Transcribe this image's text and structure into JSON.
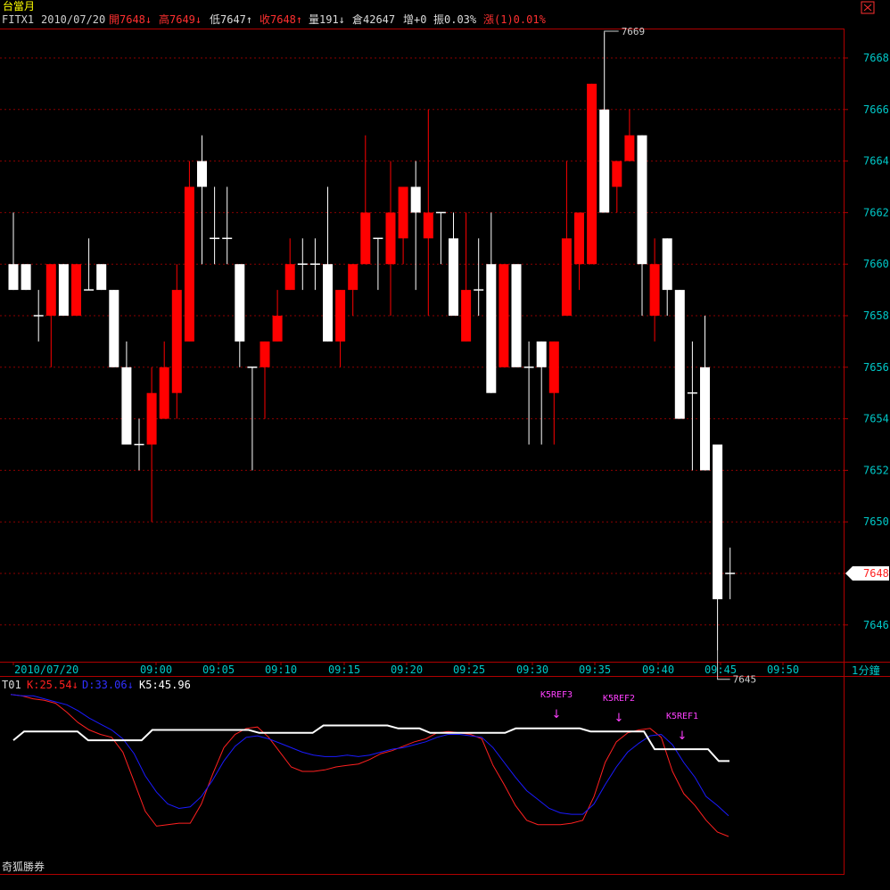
{
  "header": {
    "contract_title": "台當月",
    "symbol": "FITX1",
    "date": "2010/07/20",
    "open_label": "開7648↓",
    "high_label": "高7649↓",
    "low_label": "低7647↑",
    "close_label": "收7648↑",
    "volume_label": "量191↓",
    "oi_label": "倉42647",
    "oi_change_label": "增+0",
    "amplitude_label": "振0.03%",
    "change_label": "漲(1)0.01%",
    "close_button": "⊠"
  },
  "price_panel": {
    "axis_labels": [
      "7668",
      "7666",
      "7664",
      "7662",
      "7660",
      "7658",
      "7656",
      "7654",
      "7652",
      "7650",
      "7648",
      "7646"
    ],
    "current_price_tag": "7648",
    "high_annotation": "7669",
    "low_annotation": "7645",
    "time_labels": [
      "2010/07/20",
      "09:00",
      "09:05",
      "09:10",
      "09:15",
      "09:20",
      "09:25",
      "09:30",
      "09:35",
      "09:40",
      "09:45",
      "09:50"
    ],
    "interval_label": "1分鐘"
  },
  "indicator_panel": {
    "name": "T01",
    "k_label": "K:25.54↓",
    "d_label": "D:33.06↓",
    "k5_label": "K5:45.96",
    "markers": [
      {
        "label": "K5REF3",
        "arrow": "↓"
      },
      {
        "label": "K5REF2",
        "arrow": "↓"
      },
      {
        "label": "K5REF1",
        "arrow": "↓"
      }
    ]
  },
  "footer": {
    "brand": "奇狐勝券"
  },
  "colors": {
    "background": "#000000",
    "up_candle": "#ff0000",
    "down_candle": "#ffffff",
    "axis_text": "#00c8c8",
    "grid": "#8b0000",
    "k_line": "#ff2020",
    "d_line": "#1a1aff",
    "k5_line": "#ffffff",
    "marker_text": "#ff40ff",
    "title_yellow": "#ffff00"
  },
  "chart_data": [
    {
      "type": "candlestick",
      "title": "FITX1 1分鐘",
      "y_range": [
        7644.5,
        7670
      ],
      "candles": [
        {
          "o": 7660,
          "h": 7662,
          "l": 7659,
          "c": 7659
        },
        {
          "o": 7660,
          "h": 7660,
          "l": 7659,
          "c": 7659
        },
        {
          "o": 7658,
          "h": 7659,
          "l": 7657,
          "c": 7658
        },
        {
          "o": 7658,
          "h": 7660,
          "l": 7656,
          "c": 7660
        },
        {
          "o": 7660,
          "h": 7660,
          "l": 7658,
          "c": 7658
        },
        {
          "o": 7658,
          "h": 7660,
          "l": 7658,
          "c": 7660
        },
        {
          "o": 7659,
          "h": 7661,
          "l": 7659,
          "c": 7659
        },
        {
          "o": 7660,
          "h": 7660,
          "l": 7659,
          "c": 7659
        },
        {
          "o": 7659,
          "h": 7659,
          "l": 7656,
          "c": 7656
        },
        {
          "o": 7656,
          "h": 7657,
          "l": 7653,
          "c": 7653
        },
        {
          "o": 7653,
          "h": 7654,
          "l": 7652,
          "c": 7653
        },
        {
          "o": 7653,
          "h": 7656,
          "l": 7650,
          "c": 7655
        },
        {
          "o": 7654,
          "h": 7657,
          "l": 7654,
          "c": 7656
        },
        {
          "o": 7655,
          "h": 7660,
          "l": 7654,
          "c": 7659
        },
        {
          "o": 7657,
          "h": 7664,
          "l": 7657,
          "c": 7663
        },
        {
          "o": 7664,
          "h": 7665,
          "l": 7660,
          "c": 7663
        },
        {
          "o": 7661,
          "h": 7663,
          "l": 7660,
          "c": 7661
        },
        {
          "o": 7661,
          "h": 7663,
          "l": 7660,
          "c": 7661
        },
        {
          "o": 7660,
          "h": 7660,
          "l": 7656,
          "c": 7657
        },
        {
          "o": 7656,
          "h": 7656,
          "l": 7652,
          "c": 7656
        },
        {
          "o": 7656,
          "h": 7657,
          "l": 7654,
          "c": 7657
        },
        {
          "o": 7657,
          "h": 7659,
          "l": 7657,
          "c": 7658
        },
        {
          "o": 7659,
          "h": 7661,
          "l": 7659,
          "c": 7660
        },
        {
          "o": 7660,
          "h": 7661,
          "l": 7659,
          "c": 7660
        },
        {
          "o": 7660,
          "h": 7661,
          "l": 7659,
          "c": 7660
        },
        {
          "o": 7660,
          "h": 7663,
          "l": 7657,
          "c": 7657
        },
        {
          "o": 7657,
          "h": 7659,
          "l": 7656,
          "c": 7659
        },
        {
          "o": 7659,
          "h": 7660,
          "l": 7658,
          "c": 7660
        },
        {
          "o": 7660,
          "h": 7665,
          "l": 7660,
          "c": 7662
        },
        {
          "o": 7661,
          "h": 7661,
          "l": 7659,
          "c": 7661
        },
        {
          "o": 7660,
          "h": 7664,
          "l": 7658,
          "c": 7662
        },
        {
          "o": 7661,
          "h": 7663,
          "l": 7660,
          "c": 7663
        },
        {
          "o": 7663,
          "h": 7664,
          "l": 7659,
          "c": 7662
        },
        {
          "o": 7661,
          "h": 7666,
          "l": 7658,
          "c": 7662
        },
        {
          "o": 7662,
          "h": 7662,
          "l": 7660,
          "c": 7662
        },
        {
          "o": 7661,
          "h": 7662,
          "l": 7660,
          "c": 7658
        },
        {
          "o": 7657,
          "h": 7662,
          "l": 7657,
          "c": 7659
        },
        {
          "o": 7659,
          "h": 7661,
          "l": 7658,
          "c": 7659
        },
        {
          "o": 7660,
          "h": 7662,
          "l": 7655,
          "c": 7655
        },
        {
          "o": 7656,
          "h": 7660,
          "l": 7656,
          "c": 7660
        },
        {
          "o": 7660,
          "h": 7660,
          "l": 7656,
          "c": 7656
        },
        {
          "o": 7656,
          "h": 7657,
          "l": 7653,
          "c": 7656
        },
        {
          "o": 7657,
          "h": 7657,
          "l": 7653,
          "c": 7656
        },
        {
          "o": 7655,
          "h": 7657,
          "l": 7653,
          "c": 7657
        },
        {
          "o": 7658,
          "h": 7664,
          "l": 7658,
          "c": 7661
        },
        {
          "o": 7660,
          "h": 7662,
          "l": 7659,
          "c": 7662
        },
        {
          "o": 7660,
          "h": 7667,
          "l": 7660,
          "c": 7667
        },
        {
          "o": 7666,
          "h": 7669,
          "l": 7662,
          "c": 7662
        },
        {
          "o": 7663,
          "h": 7664,
          "l": 7662,
          "c": 7664
        },
        {
          "o": 7664,
          "h": 7666,
          "l": 7664,
          "c": 7665
        },
        {
          "o": 7665,
          "h": 7665,
          "l": 7658,
          "c": 7660
        },
        {
          "o": 7658,
          "h": 7661,
          "l": 7657,
          "c": 7660
        },
        {
          "o": 7661,
          "h": 7661,
          "l": 7658,
          "c": 7659
        },
        {
          "o": 7659,
          "h": 7659,
          "l": 7654,
          "c": 7654
        },
        {
          "o": 7655,
          "h": 7657,
          "l": 7652,
          "c": 7655
        },
        {
          "o": 7656,
          "h": 7658,
          "l": 7652,
          "c": 7652
        },
        {
          "o": 7653,
          "h": 7653,
          "l": 7645,
          "c": 7647
        },
        {
          "o": 7648,
          "h": 7649,
          "l": 7647,
          "c": 7648
        }
      ]
    },
    {
      "type": "line",
      "title": "T01",
      "y_range": [
        0,
        100
      ],
      "series": [
        {
          "name": "K",
          "values": [
            99,
            98,
            96,
            95,
            93,
            87,
            80,
            75,
            72,
            70,
            60,
            40,
            20,
            10,
            11,
            12,
            12,
            25,
            45,
            63,
            72,
            76,
            77,
            70,
            60,
            50,
            47,
            47,
            48,
            50,
            51,
            52,
            55,
            59,
            61,
            64,
            67,
            69,
            73,
            74,
            73,
            72,
            69,
            51,
            38,
            24,
            14,
            11,
            11,
            11,
            12,
            14,
            30,
            53,
            67,
            73,
            75,
            76,
            70,
            47,
            32,
            24,
            14,
            6,
            3
          ]
        },
        {
          "name": "D",
          "values": [
            99,
            98,
            98,
            96,
            94,
            92,
            88,
            83,
            79,
            75,
            69,
            59,
            44,
            33,
            25,
            22,
            23,
            30,
            41,
            54,
            64,
            70,
            71,
            69,
            66,
            63,
            60,
            58,
            57,
            57,
            58,
            57,
            58,
            60,
            62,
            63,
            65,
            67,
            70,
            72,
            72,
            71,
            70,
            63,
            53,
            43,
            34,
            28,
            22,
            19,
            18,
            18,
            25,
            38,
            50,
            60,
            66,
            71,
            72,
            65,
            53,
            43,
            30,
            24,
            17
          ]
        },
        {
          "name": "K5",
          "values": [
            68,
            74,
            74,
            74,
            74,
            74,
            74,
            68,
            68,
            68,
            68,
            68,
            68,
            75,
            75,
            75,
            75,
            75,
            75,
            75,
            75,
            75,
            75,
            73,
            73,
            73,
            73,
            73,
            73,
            78,
            78,
            78,
            78,
            78,
            78,
            78,
            76,
            76,
            76,
            73,
            73,
            73,
            73,
            73,
            73,
            73,
            73,
            76,
            76,
            76,
            76,
            76,
            76,
            76,
            74,
            74,
            74,
            74,
            74,
            74,
            62,
            62,
            62,
            62,
            62,
            62,
            54,
            54
          ]
        }
      ]
    }
  ]
}
